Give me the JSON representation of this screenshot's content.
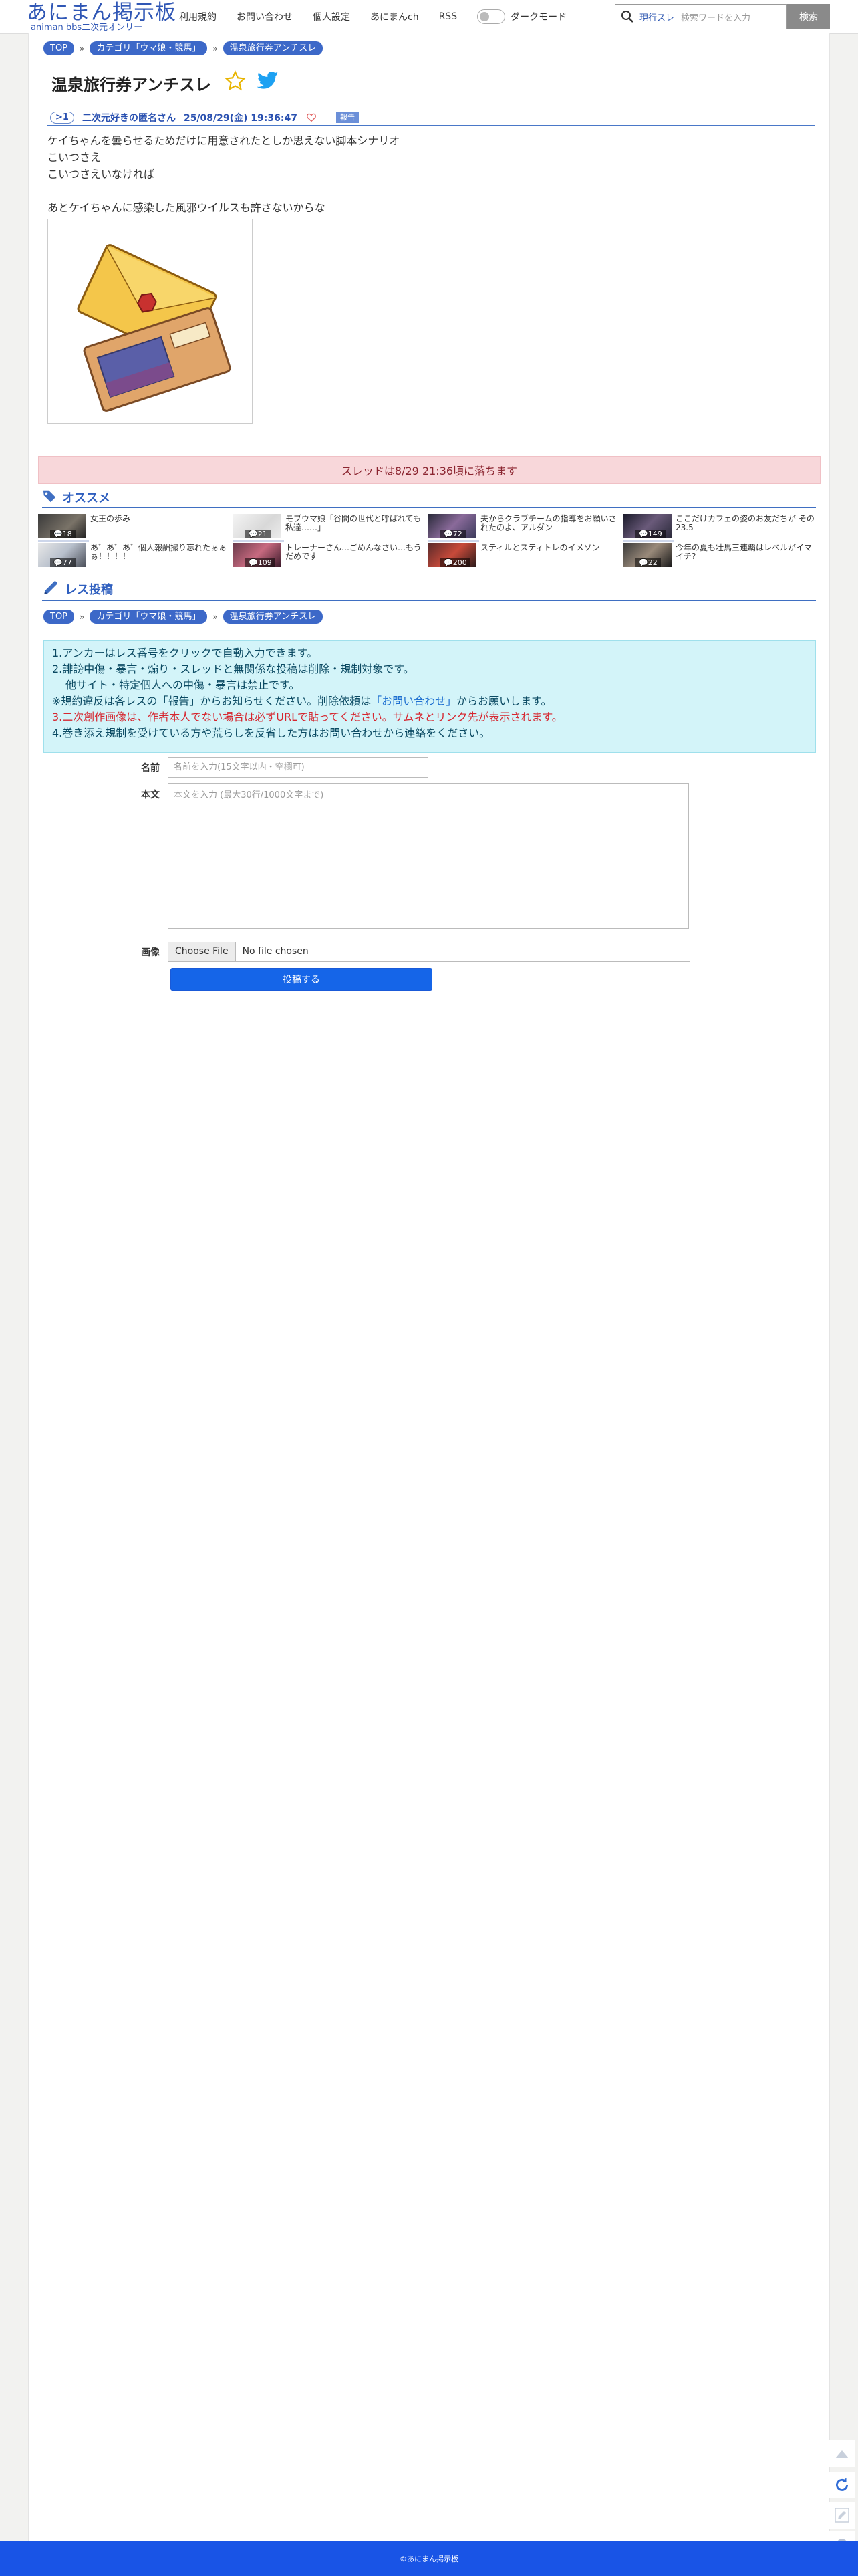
{
  "header": {
    "logo_title": "あにまん掲示板",
    "logo_sub": "animan bbs二次元オンリー",
    "nav": [
      "利用規約",
      "お問い合わせ",
      "個人設定",
      "あにまんch",
      "RSS"
    ],
    "dark_mode_label": "ダークモード",
    "search_category": "現行スレ",
    "search_placeholder": "検索ワードを入力",
    "search_button": "検索"
  },
  "breadcrumb": [
    "TOP",
    "カテゴリ「ウマ娘・競馬」",
    "温泉旅行券アンチスレ"
  ],
  "thread": {
    "title": "温泉旅行券アンチスレ",
    "post": {
      "res_no": ">1",
      "poster": "二次元好きの匿名さん",
      "date": "25/08/29(金) 19:36:47",
      "report": "報告",
      "body": "ケイちゃんを曇らせるためだけに用意されたとしか思えない脚本シナリオ\nこいつさえ\nこいつさえいなければ\n\nあとケイちゃんに感染した風邪ウイルスも許さないからな"
    }
  },
  "notice": "スレッドは8/29 21:36頃に落ちます",
  "recommend": {
    "title": "オススメ",
    "items": [
      {
        "title": "女王の歩み",
        "count": "18"
      },
      {
        "title": "あ゛あ゛あ゛個人報酬撮り忘れたぁぁぁ！！！！",
        "count": "77"
      },
      {
        "title": "モブウマ娘「谷間の世代と呼ばれても私達……」",
        "count": "21"
      },
      {
        "title": "トレーナーさん…ごめんなさい…もうだめです",
        "count": "109"
      },
      {
        "title": "夫からクラブチームの指導をお願いされたのよ、アルダン",
        "count": "72"
      },
      {
        "title": "スティルとスティトレのイメソン",
        "count": "200"
      },
      {
        "title": "ここだけカフェの姿のお友だちが その23.5",
        "count": "149"
      },
      {
        "title": "今年の夏も壮馬三連覇はレベルがイマイチ?",
        "count": "22"
      }
    ]
  },
  "reply": {
    "title": "レス投稿",
    "rules": [
      "1.アンカーはレス番号をクリックで自動入力できます。",
      "2.誹謗中傷・暴言・煽り・スレッドと無関係な投稿は削除・規制対象です。",
      "他サイト・特定個人への中傷・暴言は禁止です。",
      "※規約違反は各レスの「報告」からお知らせください。削除依頼は",
      "「お問い合わせ」",
      "からお願いします。",
      "3.",
      "二次創作画像は、作者本人でない場合は必ずURLで貼ってください。サムネとリンク先が表示されます。",
      "4.巻き添え規制を受けている方や荒らしを反省した方はお問い合わせから連絡をください。"
    ],
    "name_label": "名前",
    "name_placeholder": "名前を入力(15文字以内・空欄可)",
    "body_label": "本文",
    "body_placeholder": "本文を入力 (最大30行/1000文字まで)",
    "image_label": "画像",
    "file_button": "Choose File",
    "file_none": "No file chosen",
    "submit": "投稿する"
  },
  "footer": "©あにまん掲示板"
}
